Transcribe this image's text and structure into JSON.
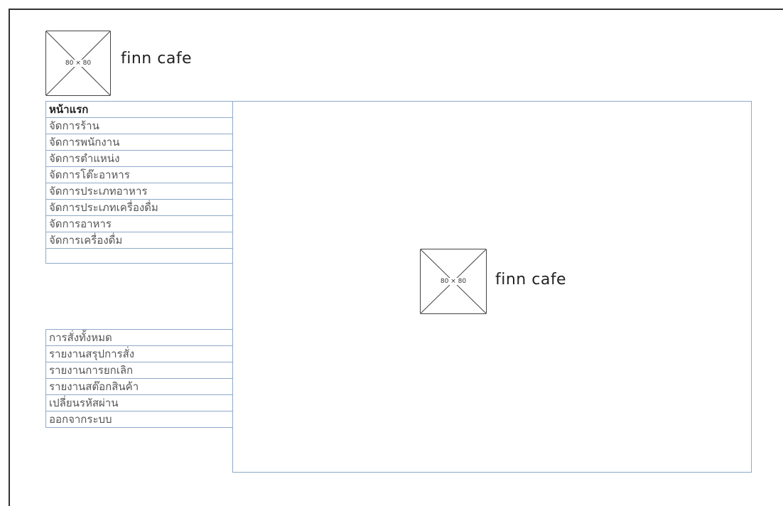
{
  "header": {
    "logo_placeholder": "80 × 80",
    "brand": "finn cafe"
  },
  "menu_primary": [
    {
      "label": "หน้าแรก",
      "active": true
    },
    {
      "label": "จัดการร้าน",
      "active": false
    },
    {
      "label": "จัดการพนักงาน",
      "active": false
    },
    {
      "label": "จัดการตำแหน่ง",
      "active": false
    },
    {
      "label": "จัดการโต๊ะอาหาร",
      "active": false
    },
    {
      "label": "จัดการประเภทอาหาร",
      "active": false
    },
    {
      "label": "จัดการประเภทเครื่องดื่ม",
      "active": false
    },
    {
      "label": "จัดการอาหาร",
      "active": false
    },
    {
      "label": "จัดการเครื่องดื่ม",
      "active": false
    }
  ],
  "menu_secondary": [
    {
      "label": "การสั่งทั้งหมด"
    },
    {
      "label": "รายงานสรุปการสั่ง"
    },
    {
      "label": "รายงานการยกเลิก"
    },
    {
      "label": "รายงานสต๊อกสินค้า"
    },
    {
      "label": "เปลี่ยนรหัสผ่าน"
    },
    {
      "label": "ออกจากระบบ"
    }
  ],
  "main": {
    "logo_placeholder": "80 × 80",
    "brand": "finn cafe"
  },
  "colors": {
    "border": "#8fa9c9",
    "frame": "#333333"
  }
}
